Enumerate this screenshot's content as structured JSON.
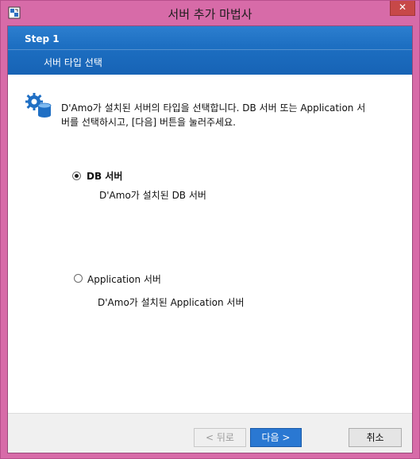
{
  "window": {
    "title": "서버 추가 마법사",
    "close_label": "✕"
  },
  "header": {
    "step": "Step 1",
    "subtitle": "서버 타입 선택"
  },
  "description": {
    "line1": "D'Amo가 설치된 서버의 타입을 선택합니다. DB 서버 또는 Application 서",
    "line2": "버를 선택하시고, [다음] 버튼을 눌러주세요."
  },
  "options": [
    {
      "label": "DB 서버",
      "description": "D'Amo가 설치된 DB 서버",
      "selected": true
    },
    {
      "label": "Application 서버",
      "description": "D'Amo가 설치된 Application 서버",
      "selected": false
    }
  ],
  "buttons": {
    "back": "< 뒤로",
    "next": "다음 >",
    "cancel": "취소"
  },
  "colors": {
    "header": "#1d6fc2",
    "frame": "#d76ba8",
    "primary_button": "#2a78d2"
  }
}
